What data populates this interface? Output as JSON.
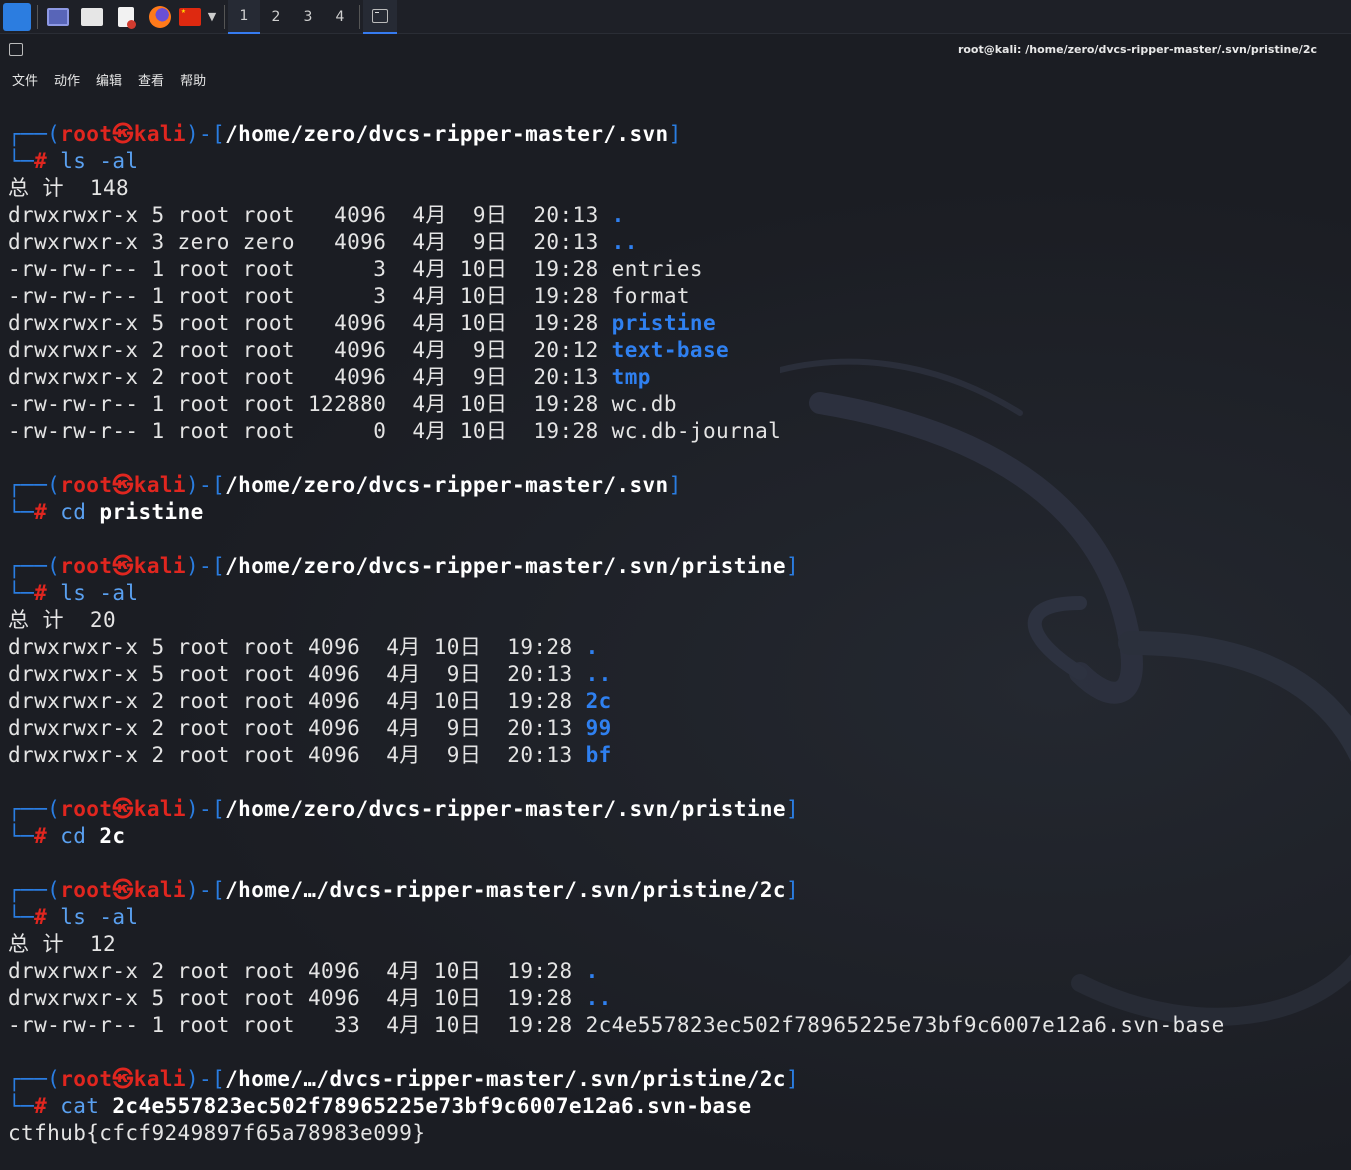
{
  "panel": {
    "workspaces": [
      "1",
      "2",
      "3",
      "4"
    ],
    "active_workspace": "1",
    "icons": [
      "kali-menu-icon",
      "terminal-icon",
      "file-manager-icon",
      "text-editor-icon",
      "firefox-icon",
      "flag-icon",
      "chevron-down-icon",
      "terminal-task-icon"
    ]
  },
  "window": {
    "title": "root@kali: /home/zero/dvcs-ripper-master/.svn/pristine/2c"
  },
  "menu": [
    "文件",
    "动作",
    "编辑",
    "查看",
    "帮助"
  ],
  "terminal": {
    "user": "root",
    "host": "kali",
    "blocks": [
      {
        "path": "/home/zero/dvcs-ripper-master/.svn",
        "cmd": "ls",
        "arg": "-al",
        "output": [
          {
            "text": "总 计  148"
          },
          {
            "text": "drwxrwxr-x 5 root root   4096  4月  9日  20:13 ",
            "name": ".",
            "type": "dir"
          },
          {
            "text": "drwxrwxr-x 3 zero zero   4096  4月  9日  20:13 ",
            "name": "..",
            "type": "dir"
          },
          {
            "text": "-rw-rw-r-- 1 root root      3  4月 10日  19:28 ",
            "name": "entries",
            "type": "file"
          },
          {
            "text": "-rw-rw-r-- 1 root root      3  4月 10日  19:28 ",
            "name": "format",
            "type": "file"
          },
          {
            "text": "drwxrwxr-x 5 root root   4096  4月 10日  19:28 ",
            "name": "pristine",
            "type": "dir"
          },
          {
            "text": "drwxrwxr-x 2 root root   4096  4月  9日  20:12 ",
            "name": "text-base",
            "type": "dir"
          },
          {
            "text": "drwxrwxr-x 2 root root   4096  4月  9日  20:13 ",
            "name": "tmp",
            "type": "dir"
          },
          {
            "text": "-rw-rw-r-- 1 root root 122880  4月 10日  19:28 ",
            "name": "wc.db",
            "type": "file"
          },
          {
            "text": "-rw-rw-r-- 1 root root      0  4月 10日  19:28 ",
            "name": "wc.db-journal",
            "type": "file"
          }
        ]
      },
      {
        "path": "/home/zero/dvcs-ripper-master/.svn",
        "cmd": "cd",
        "arg": "pristine",
        "output": []
      },
      {
        "path": "/home/zero/dvcs-ripper-master/.svn/pristine",
        "cmd": "ls",
        "arg": "-al",
        "output": [
          {
            "text": "总 计  20"
          },
          {
            "text": "drwxrwxr-x 5 root root 4096  4月 10日  19:28 ",
            "name": ".",
            "type": "dir"
          },
          {
            "text": "drwxrwxr-x 5 root root 4096  4月  9日  20:13 ",
            "name": "..",
            "type": "dir"
          },
          {
            "text": "drwxrwxr-x 2 root root 4096  4月 10日  19:28 ",
            "name": "2c",
            "type": "dir"
          },
          {
            "text": "drwxrwxr-x 2 root root 4096  4月  9日  20:13 ",
            "name": "99",
            "type": "dir"
          },
          {
            "text": "drwxrwxr-x 2 root root 4096  4月  9日  20:13 ",
            "name": "bf",
            "type": "dir"
          }
        ]
      },
      {
        "path": "/home/zero/dvcs-ripper-master/.svn/pristine",
        "cmd": "cd",
        "arg": "2c",
        "output": []
      },
      {
        "path": "/home/…/dvcs-ripper-master/.svn/pristine/2c",
        "cmd": "ls",
        "arg": "-al",
        "output": [
          {
            "text": "总 计  12"
          },
          {
            "text": "drwxrwxr-x 2 root root 4096  4月 10日  19:28 ",
            "name": ".",
            "type": "dir"
          },
          {
            "text": "drwxrwxr-x 5 root root 4096  4月 10日  19:28 ",
            "name": "..",
            "type": "dir"
          },
          {
            "text": "-rw-rw-r-- 1 root root   33  4月 10日  19:28 ",
            "name": "2c4e557823ec502f78965225e73bf9c6007e12a6.svn-base",
            "type": "file"
          }
        ]
      },
      {
        "path": "/home/…/dvcs-ripper-master/.svn/pristine/2c",
        "cmd": "cat",
        "arg": "2c4e557823ec502f78965225e73bf9c6007e12a6.svn-base",
        "output": [
          {
            "text": "ctfhub{cfcf9249897f65a78983e099}"
          }
        ]
      }
    ]
  },
  "colors": {
    "prompt_frame": "#2a7de1",
    "root_user": "#e0261f",
    "directory": "#2f80f0",
    "accent": "#367bf0",
    "background": "#1b1d23"
  }
}
